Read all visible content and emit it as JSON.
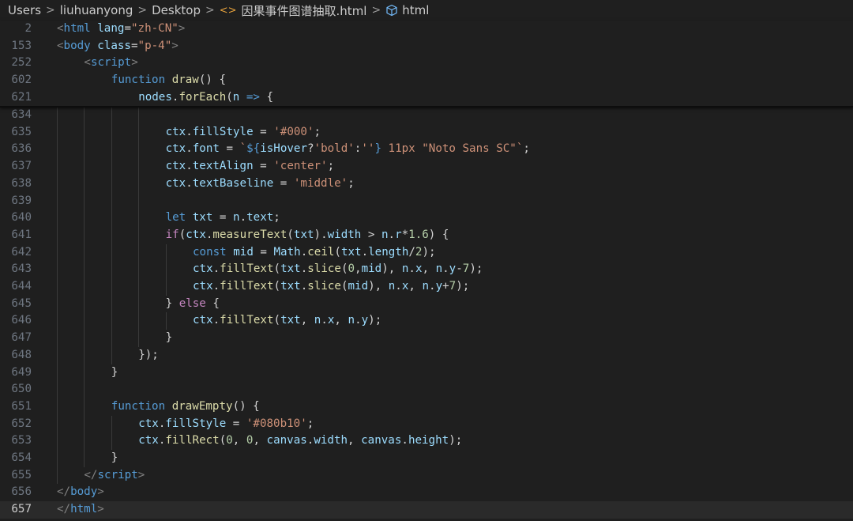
{
  "breadcrumb": {
    "items": [
      "Users",
      "liuhuanyong",
      "Desktop",
      "因果事件图谱抽取.html",
      "html"
    ],
    "separator": ">"
  },
  "editor": {
    "sticky_lines": [
      {
        "num": "2",
        "indent": 0,
        "tokens": [
          [
            "punct",
            "<"
          ],
          [
            "tag",
            "html"
          ],
          [
            "plain",
            " "
          ],
          [
            "attr",
            "lang"
          ],
          [
            "plain",
            "="
          ],
          [
            "str",
            "\"zh-CN\""
          ],
          [
            "punct",
            ">"
          ]
        ]
      },
      {
        "num": "153",
        "indent": 0,
        "tokens": [
          [
            "punct",
            "<"
          ],
          [
            "tag",
            "body"
          ],
          [
            "plain",
            " "
          ],
          [
            "attr",
            "class"
          ],
          [
            "plain",
            "="
          ],
          [
            "str",
            "\"p-4\""
          ],
          [
            "punct",
            ">"
          ]
        ]
      },
      {
        "num": "252",
        "indent": 1,
        "tokens": [
          [
            "punct",
            "<"
          ],
          [
            "tag",
            "script"
          ],
          [
            "punct",
            ">"
          ]
        ]
      },
      {
        "num": "602",
        "indent": 2,
        "tokens": [
          [
            "kw",
            "function"
          ],
          [
            "plain",
            " "
          ],
          [
            "fn",
            "draw"
          ],
          [
            "plain",
            "() {"
          ]
        ]
      },
      {
        "num": "621",
        "indent": 3,
        "tokens": [
          [
            "var",
            "nodes"
          ],
          [
            "plain",
            "."
          ],
          [
            "fn",
            "forEach"
          ],
          [
            "plain",
            "("
          ],
          [
            "var",
            "n"
          ],
          [
            "plain",
            " "
          ],
          [
            "kw",
            "=>"
          ],
          [
            "plain",
            " {"
          ]
        ]
      }
    ],
    "lines": [
      {
        "num": "634",
        "indent": 4,
        "tokens": []
      },
      {
        "num": "635",
        "indent": 4,
        "tokens": [
          [
            "var",
            "ctx"
          ],
          [
            "plain",
            "."
          ],
          [
            "var",
            "fillStyle"
          ],
          [
            "plain",
            " = "
          ],
          [
            "str",
            "'#000'"
          ],
          [
            "plain",
            ";"
          ]
        ]
      },
      {
        "num": "636",
        "indent": 4,
        "tokens": [
          [
            "var",
            "ctx"
          ],
          [
            "plain",
            "."
          ],
          [
            "var",
            "font"
          ],
          [
            "plain",
            " = "
          ],
          [
            "str",
            "`"
          ],
          [
            "tmpl",
            "${"
          ],
          [
            "var",
            "isHover"
          ],
          [
            "plain",
            "?"
          ],
          [
            "str",
            "'bold'"
          ],
          [
            "plain",
            ":"
          ],
          [
            "str",
            "''"
          ],
          [
            "tmpl",
            "}"
          ],
          [
            "str",
            " 11px \"Noto Sans SC\"`"
          ],
          [
            "plain",
            ";"
          ]
        ]
      },
      {
        "num": "637",
        "indent": 4,
        "tokens": [
          [
            "var",
            "ctx"
          ],
          [
            "plain",
            "."
          ],
          [
            "var",
            "textAlign"
          ],
          [
            "plain",
            " = "
          ],
          [
            "str",
            "'center'"
          ],
          [
            "plain",
            ";"
          ]
        ]
      },
      {
        "num": "638",
        "indent": 4,
        "tokens": [
          [
            "var",
            "ctx"
          ],
          [
            "plain",
            "."
          ],
          [
            "var",
            "textBaseline"
          ],
          [
            "plain",
            " = "
          ],
          [
            "str",
            "'middle'"
          ],
          [
            "plain",
            ";"
          ]
        ]
      },
      {
        "num": "639",
        "indent": 4,
        "tokens": []
      },
      {
        "num": "640",
        "indent": 4,
        "tokens": [
          [
            "kw",
            "let"
          ],
          [
            "plain",
            " "
          ],
          [
            "var",
            "txt"
          ],
          [
            "plain",
            " = "
          ],
          [
            "var",
            "n"
          ],
          [
            "plain",
            "."
          ],
          [
            "var",
            "text"
          ],
          [
            "plain",
            ";"
          ]
        ]
      },
      {
        "num": "641",
        "indent": 4,
        "tokens": [
          [
            "kwc",
            "if"
          ],
          [
            "plain",
            "("
          ],
          [
            "var",
            "ctx"
          ],
          [
            "plain",
            "."
          ],
          [
            "fn",
            "measureText"
          ],
          [
            "plain",
            "("
          ],
          [
            "var",
            "txt"
          ],
          [
            "plain",
            ")."
          ],
          [
            "var",
            "width"
          ],
          [
            "plain",
            " > "
          ],
          [
            "var",
            "n"
          ],
          [
            "plain",
            "."
          ],
          [
            "var",
            "r"
          ],
          [
            "plain",
            "*"
          ],
          [
            "num",
            "1.6"
          ],
          [
            "plain",
            ") {"
          ]
        ]
      },
      {
        "num": "642",
        "indent": 5,
        "tokens": [
          [
            "kw",
            "const"
          ],
          [
            "plain",
            " "
          ],
          [
            "var",
            "mid"
          ],
          [
            "plain",
            " = "
          ],
          [
            "var",
            "Math"
          ],
          [
            "plain",
            "."
          ],
          [
            "fn",
            "ceil"
          ],
          [
            "plain",
            "("
          ],
          [
            "var",
            "txt"
          ],
          [
            "plain",
            "."
          ],
          [
            "var",
            "length"
          ],
          [
            "plain",
            "/"
          ],
          [
            "num",
            "2"
          ],
          [
            "plain",
            ");"
          ]
        ]
      },
      {
        "num": "643",
        "indent": 5,
        "tokens": [
          [
            "var",
            "ctx"
          ],
          [
            "plain",
            "."
          ],
          [
            "fn",
            "fillText"
          ],
          [
            "plain",
            "("
          ],
          [
            "var",
            "txt"
          ],
          [
            "plain",
            "."
          ],
          [
            "fn",
            "slice"
          ],
          [
            "plain",
            "("
          ],
          [
            "num",
            "0"
          ],
          [
            "plain",
            ","
          ],
          [
            "var",
            "mid"
          ],
          [
            "plain",
            "), "
          ],
          [
            "var",
            "n"
          ],
          [
            "plain",
            "."
          ],
          [
            "var",
            "x"
          ],
          [
            "plain",
            ", "
          ],
          [
            "var",
            "n"
          ],
          [
            "plain",
            "."
          ],
          [
            "var",
            "y"
          ],
          [
            "plain",
            "-"
          ],
          [
            "num",
            "7"
          ],
          [
            "plain",
            ");"
          ]
        ]
      },
      {
        "num": "644",
        "indent": 5,
        "tokens": [
          [
            "var",
            "ctx"
          ],
          [
            "plain",
            "."
          ],
          [
            "fn",
            "fillText"
          ],
          [
            "plain",
            "("
          ],
          [
            "var",
            "txt"
          ],
          [
            "plain",
            "."
          ],
          [
            "fn",
            "slice"
          ],
          [
            "plain",
            "("
          ],
          [
            "var",
            "mid"
          ],
          [
            "plain",
            "), "
          ],
          [
            "var",
            "n"
          ],
          [
            "plain",
            "."
          ],
          [
            "var",
            "x"
          ],
          [
            "plain",
            ", "
          ],
          [
            "var",
            "n"
          ],
          [
            "plain",
            "."
          ],
          [
            "var",
            "y"
          ],
          [
            "plain",
            "+"
          ],
          [
            "num",
            "7"
          ],
          [
            "plain",
            ");"
          ]
        ]
      },
      {
        "num": "645",
        "indent": 4,
        "tokens": [
          [
            "plain",
            "} "
          ],
          [
            "kwc",
            "else"
          ],
          [
            "plain",
            " {"
          ]
        ]
      },
      {
        "num": "646",
        "indent": 5,
        "tokens": [
          [
            "var",
            "ctx"
          ],
          [
            "plain",
            "."
          ],
          [
            "fn",
            "fillText"
          ],
          [
            "plain",
            "("
          ],
          [
            "var",
            "txt"
          ],
          [
            "plain",
            ", "
          ],
          [
            "var",
            "n"
          ],
          [
            "plain",
            "."
          ],
          [
            "var",
            "x"
          ],
          [
            "plain",
            ", "
          ],
          [
            "var",
            "n"
          ],
          [
            "plain",
            "."
          ],
          [
            "var",
            "y"
          ],
          [
            "plain",
            ");"
          ]
        ]
      },
      {
        "num": "647",
        "indent": 4,
        "tokens": [
          [
            "plain",
            "}"
          ]
        ]
      },
      {
        "num": "648",
        "indent": 3,
        "tokens": [
          [
            "plain",
            "});"
          ]
        ]
      },
      {
        "num": "649",
        "indent": 2,
        "tokens": [
          [
            "plain",
            "}"
          ]
        ]
      },
      {
        "num": "650",
        "indent": 2,
        "tokens": []
      },
      {
        "num": "651",
        "indent": 2,
        "tokens": [
          [
            "kw",
            "function"
          ],
          [
            "plain",
            " "
          ],
          [
            "fn",
            "drawEmpty"
          ],
          [
            "plain",
            "() {"
          ]
        ]
      },
      {
        "num": "652",
        "indent": 3,
        "tokens": [
          [
            "var",
            "ctx"
          ],
          [
            "plain",
            "."
          ],
          [
            "var",
            "fillStyle"
          ],
          [
            "plain",
            " = "
          ],
          [
            "str",
            "'#080b10'"
          ],
          [
            "plain",
            ";"
          ]
        ]
      },
      {
        "num": "653",
        "indent": 3,
        "tokens": [
          [
            "var",
            "ctx"
          ],
          [
            "plain",
            "."
          ],
          [
            "fn",
            "fillRect"
          ],
          [
            "plain",
            "("
          ],
          [
            "num",
            "0"
          ],
          [
            "plain",
            ", "
          ],
          [
            "num",
            "0"
          ],
          [
            "plain",
            ", "
          ],
          [
            "var",
            "canvas"
          ],
          [
            "plain",
            "."
          ],
          [
            "var",
            "width"
          ],
          [
            "plain",
            ", "
          ],
          [
            "var",
            "canvas"
          ],
          [
            "plain",
            "."
          ],
          [
            "var",
            "height"
          ],
          [
            "plain",
            ");"
          ]
        ]
      },
      {
        "num": "654",
        "indent": 2,
        "tokens": [
          [
            "plain",
            "}"
          ]
        ]
      },
      {
        "num": "655",
        "indent": 1,
        "tokens": [
          [
            "punct",
            "</"
          ],
          [
            "tag",
            "script"
          ],
          [
            "punct",
            ">"
          ]
        ]
      },
      {
        "num": "656",
        "indent": 0,
        "tokens": [
          [
            "punct",
            "</"
          ],
          [
            "tag",
            "body"
          ],
          [
            "punct",
            ">"
          ]
        ]
      },
      {
        "num": "657",
        "indent": 0,
        "tokens": [
          [
            "punct",
            "</"
          ],
          [
            "tag",
            "html"
          ],
          [
            "punct",
            ">"
          ]
        ],
        "current": true
      }
    ]
  }
}
